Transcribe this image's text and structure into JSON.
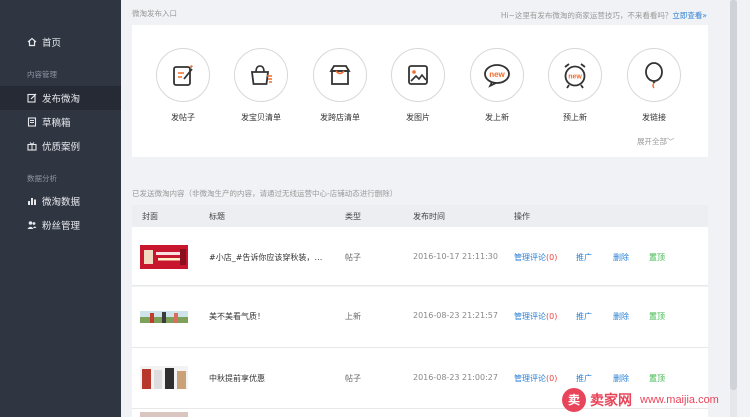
{
  "sidebar": {
    "home": "首页",
    "section_content": "内容管理",
    "publish": "发布微淘",
    "drafts": "草稿箱",
    "cases": "优质案例",
    "section_data": "数据分析",
    "weitao_data": "微淘数据",
    "fans": "粉丝管理"
  },
  "publish_panel": {
    "title": "微淘发布入口",
    "hint_text": "Hi~这里有发布微淘的商家运营技巧，不来看看吗？",
    "hint_link": "立即查看»",
    "items": [
      {
        "label": "发帖子",
        "icon": "post-edit-icon"
      },
      {
        "label": "发宝贝清单",
        "icon": "bag-list-icon"
      },
      {
        "label": "发跨店清单",
        "icon": "store-box-icon"
      },
      {
        "label": "发图片",
        "icon": "image-icon"
      },
      {
        "label": "发上新",
        "icon": "new-badge-icon"
      },
      {
        "label": "预上新",
        "icon": "alarm-new-icon"
      },
      {
        "label": "发链接",
        "icon": "balloon-link-icon"
      }
    ],
    "expand_all": "展开全部﹀"
  },
  "list": {
    "note": "已发送微淘内容（非微淘生产的内容，请通过无线运营中心-店铺动态进行删除）",
    "headers": {
      "cover": "封面",
      "title": "标题",
      "type": "类型",
      "time": "发布时间",
      "action": "操作"
    },
    "rows": [
      {
        "title": "#小店_#告诉你应该穿秋装，不...",
        "type": "帖子",
        "time": "2016-10-17 21:11:30",
        "manage": "管理评论",
        "count": "(0)",
        "promote": "推广",
        "delete": "删除",
        "top": "置顶"
      },
      {
        "title": "美不美看气质！",
        "type": "上新",
        "time": "2016-08-23 21:21:57",
        "manage": "管理评论",
        "count": "(0)",
        "promote": "推广",
        "delete": "删除",
        "top": "置顶"
      },
      {
        "title": "中秋提前享优惠",
        "type": "帖子",
        "time": "2016-08-23 21:00:27",
        "manage": "管理评论",
        "count": "(0)",
        "promote": "推广",
        "delete": "删除",
        "top": "置顶"
      }
    ]
  },
  "watermark": {
    "logo": "卖",
    "text": "卖家网",
    "url": "www.maijia.com"
  },
  "colors": {
    "sidebar_bg": "#2f3541",
    "link": "#2a7fd4",
    "top_green": "#39b54a",
    "count_red": "#e44"
  }
}
